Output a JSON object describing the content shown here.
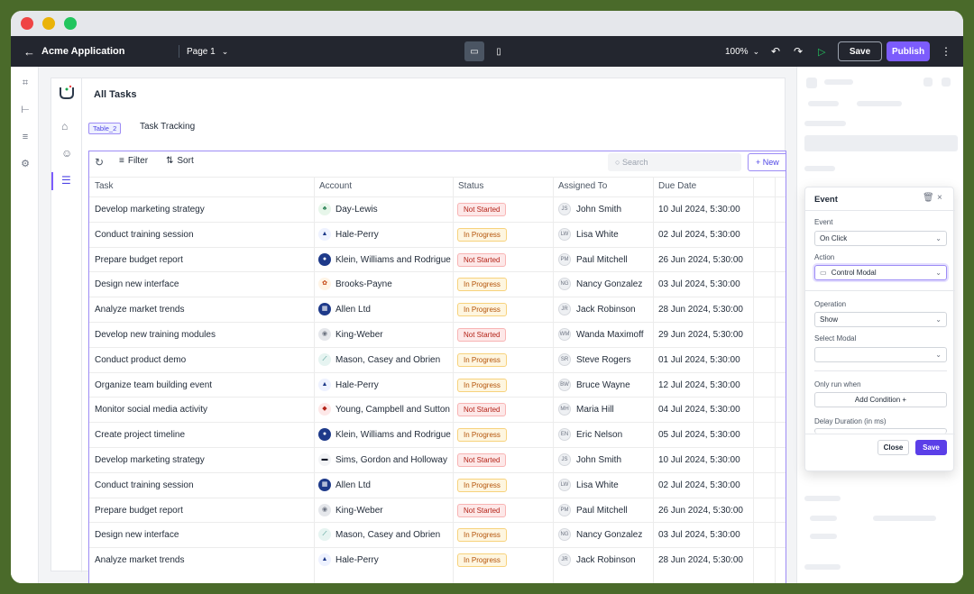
{
  "topbar": {
    "app_title": "Acme Application",
    "page": "Page 1",
    "zoom": "100%",
    "save": "Save",
    "publish": "Publish"
  },
  "app": {
    "heading": "All Tasks",
    "table_chip": "Table_2",
    "table_title": "Task Tracking"
  },
  "toolbar": {
    "filter": "Filter",
    "sort": "Sort",
    "search_placeholder": "Search",
    "new_btn": "+ New"
  },
  "columns": [
    "Task",
    "Account",
    "Status",
    "Assigned To",
    "Due Date"
  ],
  "rows": [
    {
      "task": "Develop marketing strategy",
      "account": "Day-Lewis",
      "status": "Not Started",
      "initials": "JS",
      "assignee": "John Smith",
      "due": "10 Jul 2024, 5:30:00"
    },
    {
      "task": "Conduct training session",
      "account": "Hale-Perry",
      "status": "In Progress",
      "initials": "LW",
      "assignee": "Lisa White",
      "due": "02 Jul 2024, 5:30:00"
    },
    {
      "task": "Prepare budget report",
      "account": "Klein, Williams and Rodriguez",
      "status": "Not Started",
      "initials": "PM",
      "assignee": "Paul Mitchell",
      "due": "26 Jun 2024, 5:30:00"
    },
    {
      "task": "Design new interface",
      "account": "Brooks-Payne",
      "status": "In Progress",
      "initials": "NG",
      "assignee": "Nancy Gonzalez",
      "due": "03 Jul 2024, 5:30:00"
    },
    {
      "task": "Analyze market trends",
      "account": "Allen Ltd",
      "status": "In Progress",
      "initials": "JR",
      "assignee": "Jack Robinson",
      "due": "28 Jun 2024, 5:30:00"
    },
    {
      "task": "Develop new training modules",
      "account": "King-Weber",
      "status": "Not Started",
      "initials": "WM",
      "assignee": "Wanda Maximoff",
      "due": "29 Jun 2024, 5:30:00"
    },
    {
      "task": "Conduct product demo",
      "account": "Mason, Casey and Obrien",
      "status": "In Progress",
      "initials": "SR",
      "assignee": "Steve Rogers",
      "due": "01 Jul 2024, 5:30:00"
    },
    {
      "task": "Organize team building event",
      "account": "Hale-Perry",
      "status": "In Progress",
      "initials": "BW",
      "assignee": "Bruce Wayne",
      "due": "12 Jul 2024, 5:30:00"
    },
    {
      "task": "Monitor social media activity",
      "account": "Young, Campbell and Sutton",
      "status": "Not Started",
      "initials": "MH",
      "assignee": "Maria Hill",
      "due": "04 Jul 2024, 5:30:00"
    },
    {
      "task": "Create project timeline",
      "account": "Klein, Williams and Rodriguez",
      "status": "In Progress",
      "initials": "EN",
      "assignee": "Eric Nelson",
      "due": "05 Jul 2024, 5:30:00"
    },
    {
      "task": "Develop marketing strategy",
      "account": "Sims, Gordon and Holloway",
      "status": "Not Started",
      "initials": "JS",
      "assignee": "John Smith",
      "due": "10 Jul 2024, 5:30:00"
    },
    {
      "task": "Conduct training session",
      "account": "Allen Ltd",
      "status": "In Progress",
      "initials": "LW",
      "assignee": "Lisa White",
      "due": "02 Jul 2024, 5:30:00"
    },
    {
      "task": "Prepare budget report",
      "account": "King-Weber",
      "status": "Not Started",
      "initials": "PM",
      "assignee": "Paul Mitchell",
      "due": "26 Jun 2024, 5:30:00"
    },
    {
      "task": "Design new interface",
      "account": "Mason, Casey and Obrien",
      "status": "In Progress",
      "initials": "NG",
      "assignee": "Nancy Gonzalez",
      "due": "03 Jul 2024, 5:30:00"
    },
    {
      "task": "Analyze market trends",
      "account": "Hale-Perry",
      "status": "In Progress",
      "initials": "JR",
      "assignee": "Jack Robinson",
      "due": "28 Jun 2024, 5:30:00"
    }
  ],
  "modal": {
    "title": "Event",
    "event_label": "Event",
    "event_value": "On Click",
    "action_label": "Action",
    "action_value": "Control Modal",
    "operation_label": "Operation",
    "operation_value": "Show",
    "select_modal_label": "Select Modal",
    "only_run_label": "Only run when",
    "add_condition": "Add Condition",
    "delay_label": "Delay Duration (in ms)",
    "close": "Close",
    "save": "Save"
  },
  "colors": {
    "accent": "#7c5cfc",
    "topbar": "#23262f",
    "not_started": "#b42318",
    "in_progress": "#b45309"
  }
}
